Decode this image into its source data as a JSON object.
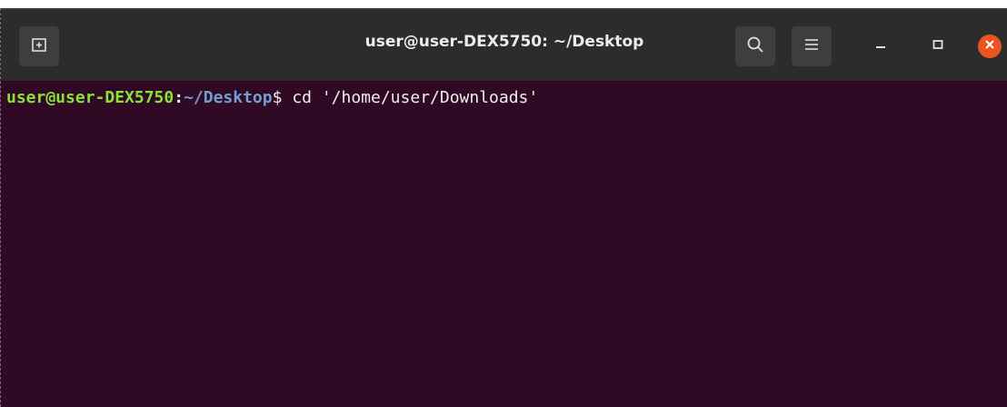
{
  "window": {
    "title": "user@user-DEX5750: ~/Desktop"
  },
  "titlebar": {
    "buttons": {
      "new_tab_icon": "new-tab-icon",
      "search_icon": "search-icon",
      "menu_icon": "hamburger-menu-icon",
      "minimize_icon": "minimize-icon",
      "maximize_icon": "maximize-icon",
      "close_icon": "close-icon"
    }
  },
  "terminal": {
    "line1": {
      "user_host": "user@user-DEX5750",
      "colon": ":",
      "path": "~/Desktop",
      "dollar": "$ ",
      "command": "cd '/home/user/Downloads'"
    }
  },
  "colors": {
    "background": "#300a24",
    "titlebar": "#2c2c2c",
    "prompt_user": "#8ae234",
    "prompt_path": "#729fcf",
    "close_button": "#e95420"
  }
}
